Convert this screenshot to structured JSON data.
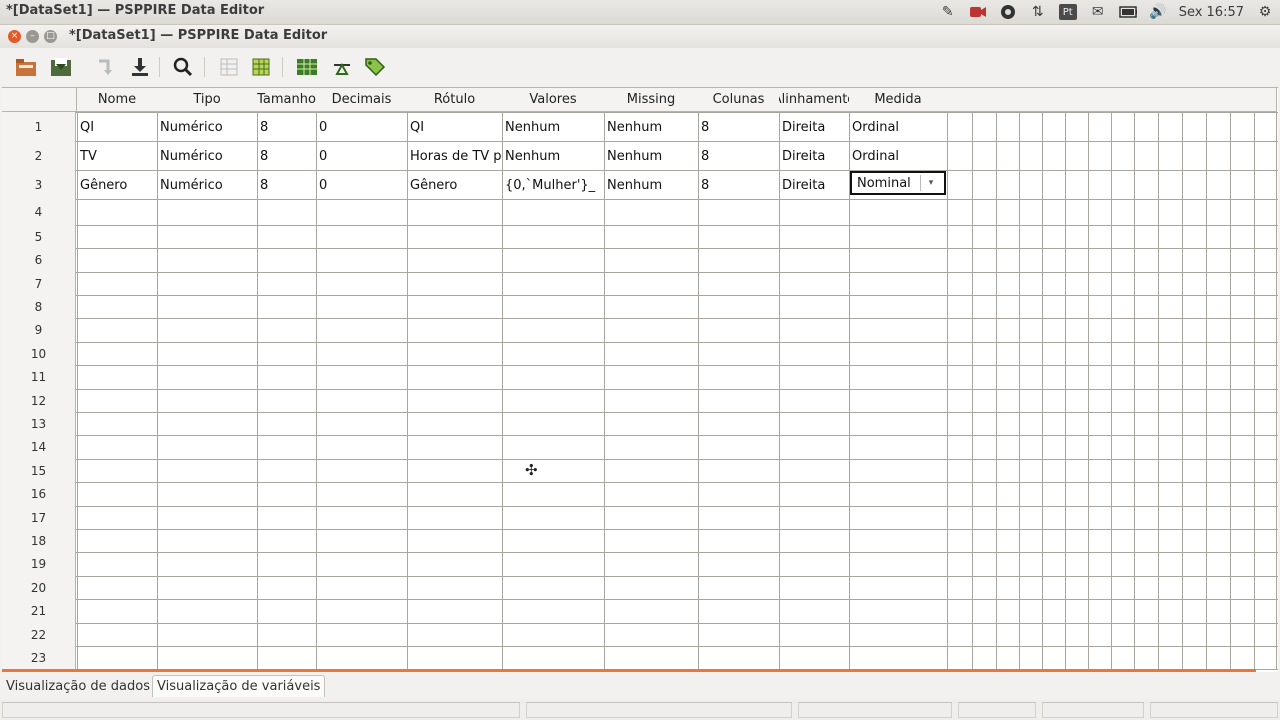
{
  "panel": {
    "app_title": "*[DataSet1] — PSPPIRE Data Editor",
    "indicators": [
      "edit-icon",
      "camera-icon",
      "update-icon",
      "network-icon",
      "keyboard-layout-icon",
      "mail-icon",
      "battery-icon",
      "volume-icon"
    ],
    "keyboard_layout": "Pt",
    "clock": "Sex 16:57"
  },
  "window": {
    "title": "*[DataSet1] — PSPPIRE Data Editor"
  },
  "grid": {
    "columns": [
      "Nome",
      "Tipo",
      "Tamanho",
      "Decimais",
      "Rótulo",
      "Valores",
      "Missing",
      "Colunas",
      "Alinhamento",
      "Medida"
    ],
    "row_numbers": [
      "1",
      "2",
      "3",
      "4",
      "5",
      "6",
      "7",
      "8",
      "9",
      "10",
      "11",
      "12",
      "13",
      "14",
      "15",
      "16",
      "17",
      "18",
      "19",
      "20",
      "21",
      "22",
      "23"
    ],
    "rows": [
      [
        "QI",
        "Numérico",
        "8",
        "0",
        "QI",
        "Nenhum",
        "Nenhum",
        "8",
        "Direita",
        "Ordinal"
      ],
      [
        "TV",
        "Numérico",
        "8",
        "0",
        "Horas de TV po",
        "Nenhum",
        "Nenhum",
        "8",
        "Direita",
        "Ordinal"
      ],
      [
        "Gênero",
        "Numérico",
        "8",
        "0",
        "Gênero",
        "{0,`Mulher'}_",
        "Nenhum",
        "8",
        "Direita",
        ""
      ]
    ],
    "editor": {
      "value": "Nominal",
      "arrow": "▾"
    }
  },
  "tabs": [
    "Visualização de dados",
    "Visualização de variáveis"
  ],
  "colors": {
    "accent": "#e8763d",
    "close": "#e15a2b"
  }
}
